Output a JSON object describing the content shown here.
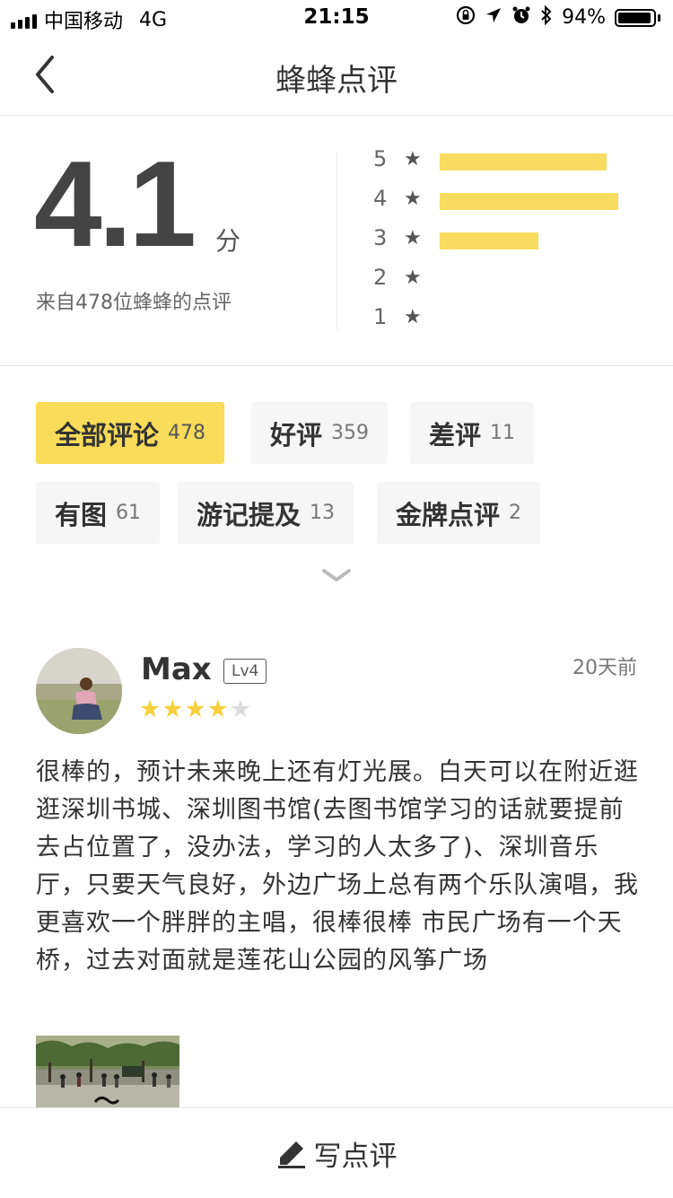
{
  "status_bar": {
    "carrier": "中国移动",
    "network": "4G",
    "time": "21:15",
    "battery": "94%",
    "battery_level": 0.94,
    "icons": [
      "lock-rotation-icon",
      "location-arrow-icon",
      "alarm-icon",
      "bluetooth-icon"
    ]
  },
  "nav": {
    "back_icon": "chevron-left-icon",
    "title": "蜂蜂点评"
  },
  "rating": {
    "score": "4.1",
    "unit": "分",
    "source": "来自478位蜂蜂的点评",
    "distribution": [
      {
        "stars": "5",
        "fraction": 0.71
      },
      {
        "stars": "4",
        "fraction": 0.76
      },
      {
        "stars": "3",
        "fraction": 0.42
      },
      {
        "stars": "2",
        "fraction": 0
      },
      {
        "stars": "1",
        "fraction": 0
      }
    ],
    "bar_color": "#f7dc60"
  },
  "filters": [
    {
      "label": "全部评论",
      "count": "478",
      "active": true
    },
    {
      "label": "好评",
      "count": "359",
      "active": false
    },
    {
      "label": "差评",
      "count": "11",
      "active": false
    },
    {
      "label": "有图",
      "count": "61",
      "active": false
    },
    {
      "label": "游记提及",
      "count": "13",
      "active": false
    },
    {
      "label": "金牌点评",
      "count": "2",
      "active": false
    }
  ],
  "accent_color": "#f8dc5a",
  "review": {
    "username": "Max",
    "level": "Lv4",
    "time": "20天前",
    "rating": 4,
    "rating_max": 5,
    "text": "很棒的，预计未来晚上还有灯光展。白天可以在附近逛逛深圳书城、深圳图书馆(去图书馆学习的话就要提前去占位置了，没办法，学习的人太多了)、深圳音乐厅，只要天气良好，外边广场上总有两个乐队演唱，我更喜欢一个胖胖的主唱，很棒很棒  市民广场有一个天桥，过去对面就是莲花山公园的风筝广场"
  },
  "bottom": {
    "write_label": "写点评",
    "write_icon": "pen-icon"
  }
}
